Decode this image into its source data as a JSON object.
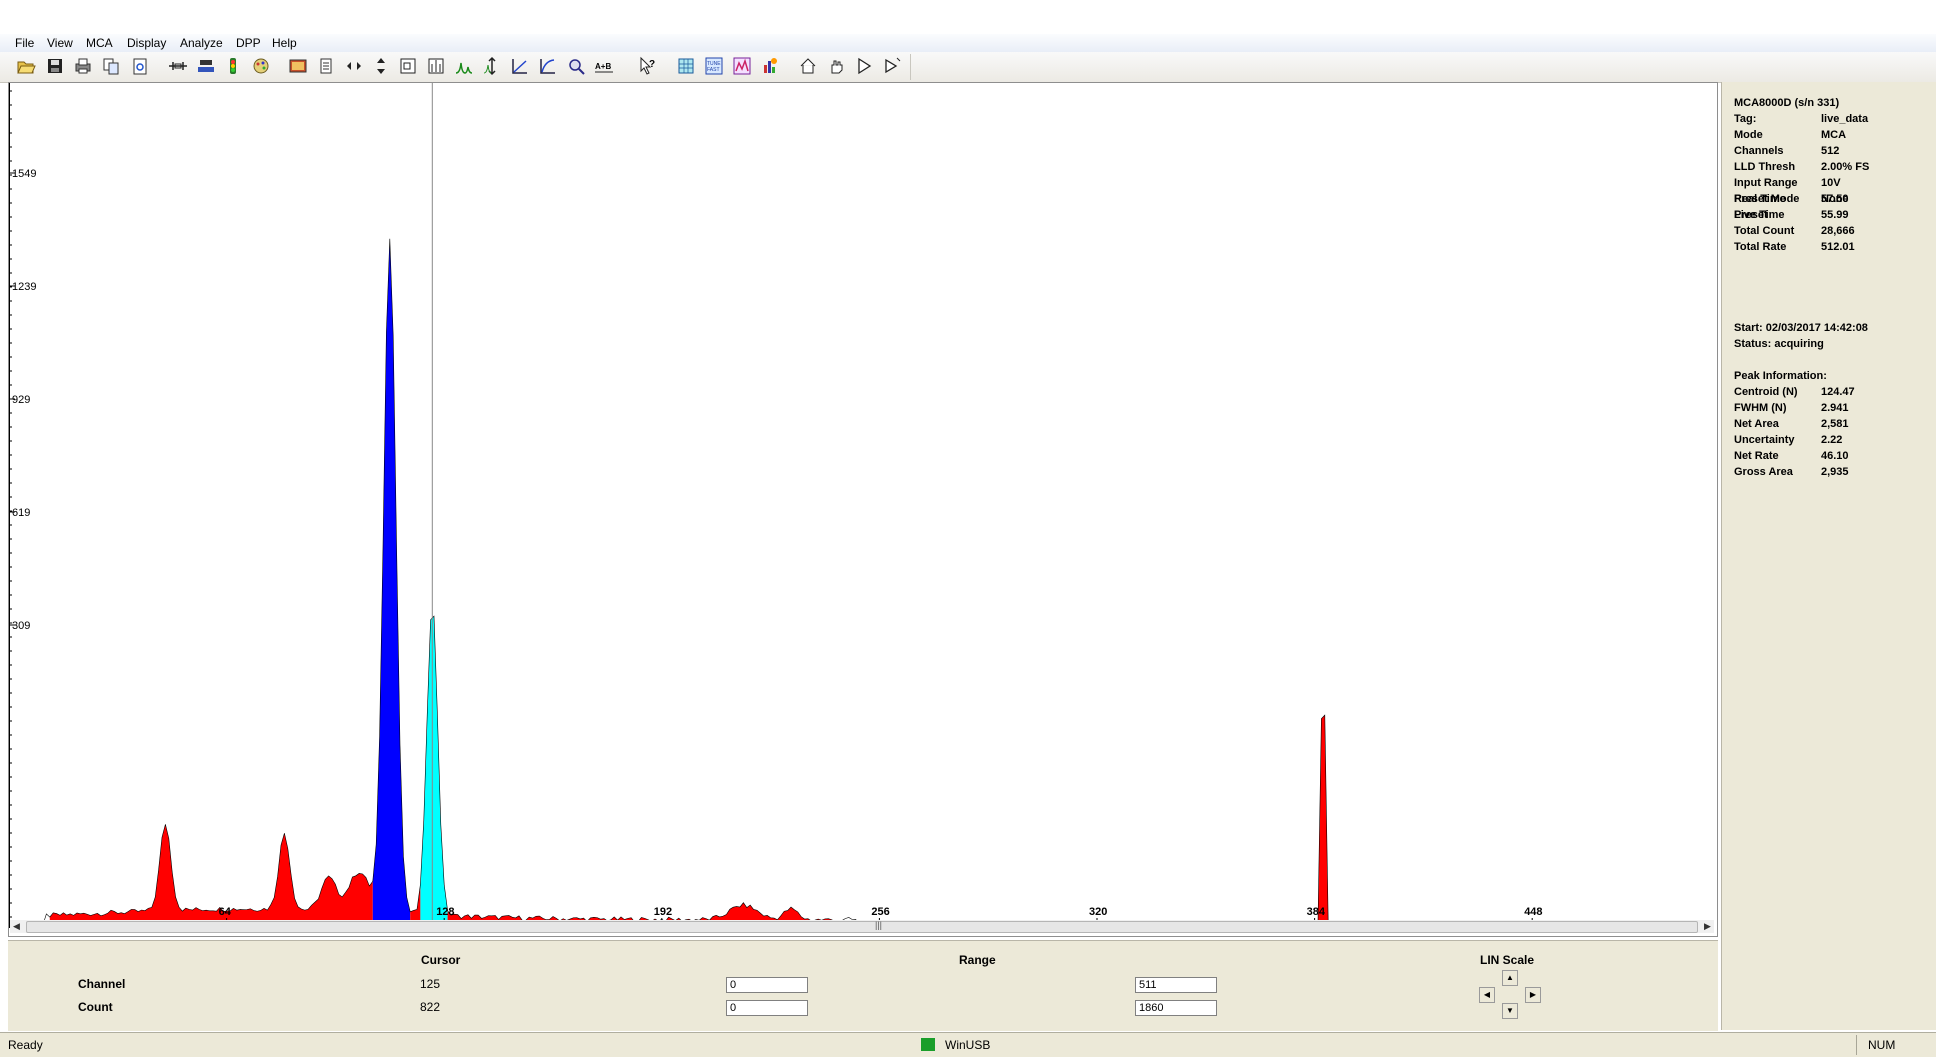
{
  "menu": [
    "File",
    "View",
    "MCA",
    "Display",
    "Analyze",
    "DPP",
    "Help"
  ],
  "toolbar_icons": [
    "open-folder-icon",
    "save-icon",
    "print-icon",
    "copy-icon",
    "print-preview-icon",
    "roi-icon",
    "roi-clear-icon",
    "peak-icon",
    "color-palette-icon",
    "properties-icon",
    "horizontal-expand-icon",
    "vertical-expand-icon",
    "zoom-window-icon",
    "zoom-fit-icon",
    "log-peak-icon",
    "auto-scale-icon",
    "lin-scale-icon",
    "log-scale-icon",
    "zoom-search-icon",
    "a-plus-b-icon",
    "help-pointer-icon",
    "grid-icon",
    "tune-fast-icon",
    "data-icon",
    "calibrate-icon",
    "home-icon",
    "hand-icon",
    "play-icon",
    "play-step-icon"
  ],
  "spectrum": {
    "y_ticks": [
      "1549",
      "1239",
      "929",
      "619",
      "309"
    ],
    "x_ticks": [
      "64",
      "128",
      "192",
      "256",
      "320",
      "384",
      "448"
    ],
    "colors": {
      "background": "#ffffff",
      "roi": "#ff0000",
      "selected_roi": "#0000ff",
      "cursor_roi": "#00ffff",
      "trace": "#000000"
    },
    "cursor_channel": 128
  },
  "bottom": {
    "cursor_label": "Cursor",
    "range_label": "Range",
    "scale_label": "LIN Scale",
    "channel_label": "Channel",
    "count_label": "Count",
    "channel_value": "125",
    "count_value": "822",
    "range_channel_min": "0",
    "range_channel_max": "511",
    "range_count_min": "0",
    "range_count_max": "1860"
  },
  "info": {
    "device": "MCA8000D (s/n     331)",
    "rows1": [
      {
        "k": "Tag:",
        "v": "live_data"
      },
      {
        "k": "Mode",
        "v": "MCA"
      },
      {
        "k": "Channels",
        "v": "512"
      },
      {
        "k": "LLD Thresh",
        "v": "2.00% FS"
      },
      {
        "k": "Input Range",
        "v": "10V"
      },
      {
        "k": "Preset Mode",
        "v": "None"
      },
      {
        "k": "Preset",
        "v": ""
      }
    ],
    "rows2": [
      {
        "k": "Real Time",
        "v": "57.50"
      },
      {
        "k": "Live Time",
        "v": "55.99"
      },
      {
        "k": "Total Count",
        "v": "28,666"
      },
      {
        "k": "Total Rate",
        "v": "512.01"
      }
    ],
    "start": "Start:  02/03/2017 14:42:08",
    "status": "Status:      acquiring",
    "peak_header": "Peak Information:",
    "rows3": [
      {
        "k": "Centroid (N)",
        "v": "124.47"
      },
      {
        "k": "FWHM (N)",
        "v": "2.941"
      },
      {
        "k": "Net Area",
        "v": "2,581"
      },
      {
        "k": "Uncertainty",
        "v": "2.22"
      },
      {
        "k": "Net Rate",
        "v": "46.10"
      },
      {
        "k": "Gross Area",
        "v": "2,935"
      }
    ]
  },
  "status": {
    "ready": "Ready",
    "connection": "WinUSB",
    "num": "NUM"
  }
}
